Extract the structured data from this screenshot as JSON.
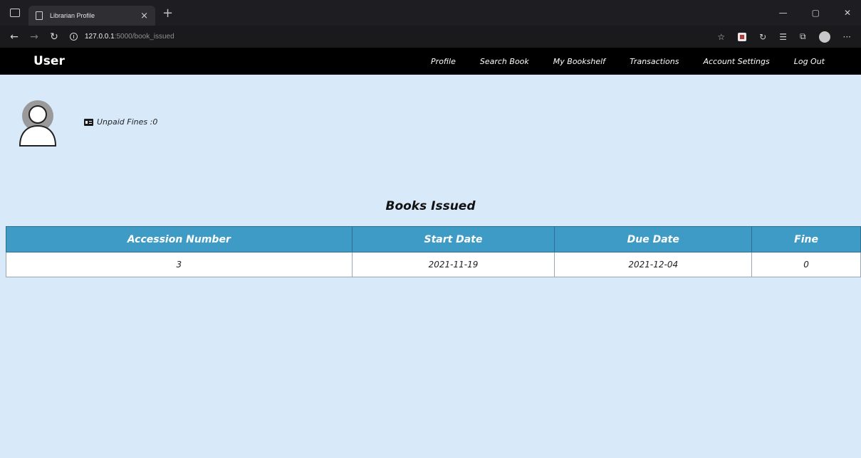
{
  "browser": {
    "tab_title": "Librarian Profile",
    "tab_close": "×",
    "new_tab": "+",
    "url_host": "127.0.0.1",
    "url_path": ":5000/book_issued"
  },
  "navbar": {
    "brand": "User",
    "links": [
      "Profile",
      "Search Book",
      "My Bookshelf",
      "Transactions",
      "Account Settings",
      "Log Out"
    ]
  },
  "profile": {
    "fines_label": "Unpaid Fines :0"
  },
  "books_issued": {
    "title": "Books Issued",
    "columns": [
      "Accession Number",
      "Start Date",
      "Due Date",
      "Fine"
    ],
    "rows": [
      [
        "3",
        "2021-11-19",
        "2021-12-04",
        "0"
      ]
    ]
  },
  "colors": {
    "page_background": "#d8e9fa",
    "navbar": "#000000",
    "table_header": "#3e9bc6"
  }
}
